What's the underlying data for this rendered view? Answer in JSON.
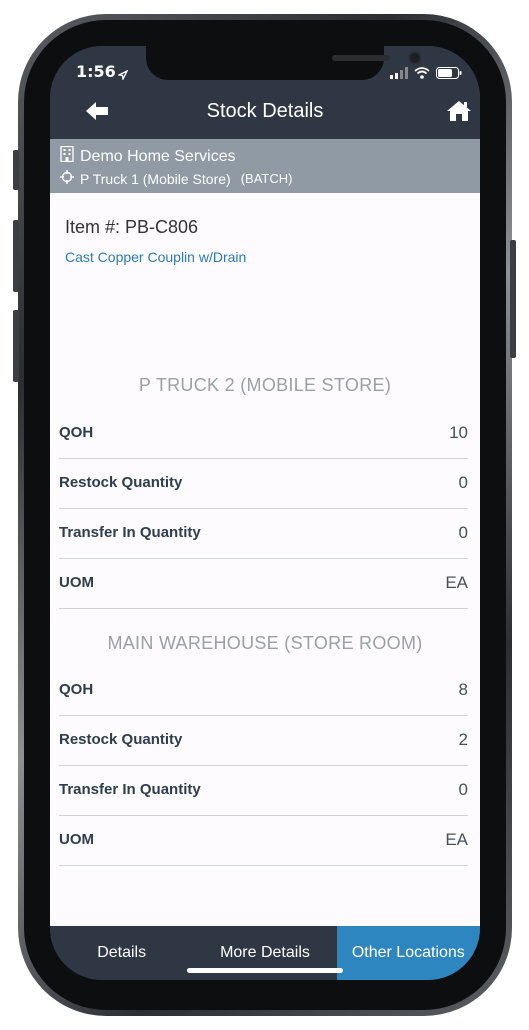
{
  "status_bar": {
    "time": "1:56"
  },
  "nav": {
    "title": "Stock Details"
  },
  "company": {
    "name": "Demo Home Services",
    "store": "P Truck 1 (Mobile Store)",
    "store_type": "(BATCH)"
  },
  "item": {
    "number_label": "Item #: PB-C806",
    "description": "Cast Copper Couplin w/Drain"
  },
  "locations": [
    {
      "title": "P TRUCK 2 (MOBILE STORE)",
      "rows": [
        {
          "label": "QOH",
          "value": "10"
        },
        {
          "label": "Restock Quantity",
          "value": "0"
        },
        {
          "label": "Transfer In Quantity",
          "value": "0"
        },
        {
          "label": "UOM",
          "value": "EA"
        }
      ]
    },
    {
      "title": "MAIN WAREHOUSE (STORE ROOM)",
      "rows": [
        {
          "label": "QOH",
          "value": "8"
        },
        {
          "label": "Restock Quantity",
          "value": "2"
        },
        {
          "label": "Transfer In Quantity",
          "value": "0"
        },
        {
          "label": "UOM",
          "value": "EA"
        }
      ]
    }
  ],
  "tabs": [
    {
      "label": "Details",
      "active": false
    },
    {
      "label": "More Details",
      "active": false
    },
    {
      "label": "Other Locations",
      "active": true
    }
  ],
  "colors": {
    "nav_bg": "#2f3745",
    "company_bg": "#8f9aa4",
    "accent": "#2e86c1",
    "link": "#2a7ac0"
  }
}
